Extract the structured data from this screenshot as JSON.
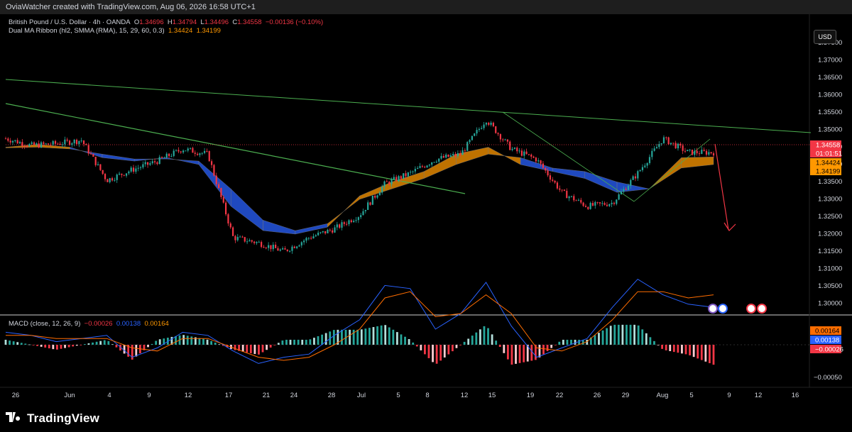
{
  "header": {
    "attribution": "OviaWatcher created with TradingView.com, Aug 06, 2026 16:58 UTC+1"
  },
  "legend": {
    "symbol": "British Pound / U.S. Dollar · 4h · OANDA",
    "o_label": "O",
    "o_value": "1.34696",
    "h_label": "H",
    "h_value": "1.34794",
    "l_label": "L",
    "l_value": "1.34496",
    "c_label": "C",
    "c_value": "1.34558",
    "change": "−0.00136 (−0.10%)",
    "ma_name": "Dual MA Ribbon (hl2, SMMA (RMA), 15, 29, 60, 0.3)",
    "ma_v1": "1.34424",
    "ma_v2": "1.34199",
    "macd_name": "MACD (close, 12, 26, 9)",
    "macd_v1": "−0.00026",
    "macd_v2": "0.00138",
    "macd_v3": "0.00164"
  },
  "currency_button": "USD",
  "price_axis": {
    "labels": [
      "1.37500",
      "1.37000",
      "1.36500",
      "1.36000",
      "1.35500",
      "1.35000",
      "1.34500",
      "1.34000",
      "1.33500",
      "1.33000",
      "1.32500",
      "1.32000",
      "1.31500",
      "1.31000",
      "1.30500",
      "1.30000"
    ],
    "current_price": "1.34558",
    "countdown": "01:01:51",
    "ma1": "1.34424",
    "ma2": "1.34199"
  },
  "macd_axis": {
    "labels": [
      "0.00164",
      "0.00138",
      "−0.00026",
      "−0.00050"
    ]
  },
  "time_axis": {
    "labels": [
      "26",
      "Jun",
      "4",
      "9",
      "12",
      "17",
      "21",
      "24",
      "28",
      "Jul",
      "5",
      "8",
      "12",
      "15",
      "19",
      "22",
      "26",
      "29",
      "Aug",
      "5",
      "9",
      "12",
      "16"
    ]
  },
  "branding": {
    "name": "TradingView"
  },
  "colors": {
    "up": "#26a69a",
    "down": "#f23645",
    "ribbon_bull": "#ff9800",
    "ribbon_bear": "#2962ff",
    "trend": "#4caf50",
    "macd": "#2962ff",
    "signal": "#ff6d00",
    "arrow": "#f23645"
  },
  "chart_data": [
    {
      "type": "candlestick",
      "title": "British Pound / U.S. Dollar · 4h · OANDA",
      "ylim": [
        1.295,
        1.378
      ],
      "x": [
        "May 26",
        "Jun 1",
        "Jun 4",
        "Jun 9",
        "Jun 12",
        "Jun 17",
        "Jun 21",
        "Jun 24",
        "Jun 28",
        "Jul 1",
        "Jul 5",
        "Jul 8",
        "Jul 12",
        "Jul 15",
        "Jul 19",
        "Jul 22",
        "Jul 26",
        "Jul 29",
        "Aug 1",
        "Aug 5"
      ],
      "price_path": [
        1.3495,
        1.3475,
        1.348,
        1.349,
        1.3375,
        1.3405,
        1.343,
        1.3465,
        1.345,
        1.321,
        1.3195,
        1.317,
        1.321,
        1.3235,
        1.3275,
        1.3365,
        1.3395,
        1.3435,
        1.345,
        1.355,
        1.3465,
        1.3435,
        1.334,
        1.33,
        1.331,
        1.3395,
        1.3495,
        1.3455,
        1.3455
      ],
      "last": 1.34558,
      "ma_fast": [
        1.347,
        1.3478,
        1.347,
        1.344,
        1.343,
        1.344,
        1.342,
        1.33,
        1.323,
        1.322,
        1.324,
        1.333,
        1.337,
        1.34,
        1.345,
        1.347,
        1.342,
        1.34,
        1.338,
        1.334,
        1.335,
        1.344,
        1.3442
      ],
      "ma_slow": [
        1.3468,
        1.347,
        1.3465,
        1.345,
        1.3436,
        1.3436,
        1.343,
        1.335,
        1.326,
        1.323,
        1.325,
        1.332,
        1.335,
        1.338,
        1.342,
        1.345,
        1.344,
        1.341,
        1.34,
        1.337,
        1.335,
        1.341,
        1.342
      ]
    },
    {
      "type": "line",
      "title": "MACD (close, 12, 26, 9)",
      "ylim": [
        -0.0007,
        0.0025
      ],
      "macd": [
        0.0004,
        0.0003,
        0.0001,
        0.0002,
        0.0003,
        -0.0004,
        -0.0001,
        0.0004,
        0.0003,
        -0.0002,
        -0.0006,
        -0.0004,
        -0.0003,
        0.0003,
        0.0008,
        0.0019,
        0.0018,
        0.0005,
        0.001,
        0.002,
        0.0006,
        -0.0004,
        -0.0001,
        0.0002,
        0.0012,
        0.0021,
        0.0016,
        0.0013,
        0.0012
      ],
      "signal": [
        0.0003,
        0.0003,
        0.0002,
        0.0002,
        0.0002,
        -0.0001,
        -0.0002,
        0.0002,
        0.0002,
        -0.0001,
        -0.0004,
        -0.0005,
        -0.0004,
        0.0,
        0.0005,
        0.0015,
        0.0017,
        0.0009,
        0.001,
        0.0016,
        0.001,
        -0.0001,
        -0.0002,
        0.0001,
        0.0008,
        0.0017,
        0.0017,
        0.0015,
        0.0016
      ],
      "histogram_last": -0.00026
    }
  ]
}
